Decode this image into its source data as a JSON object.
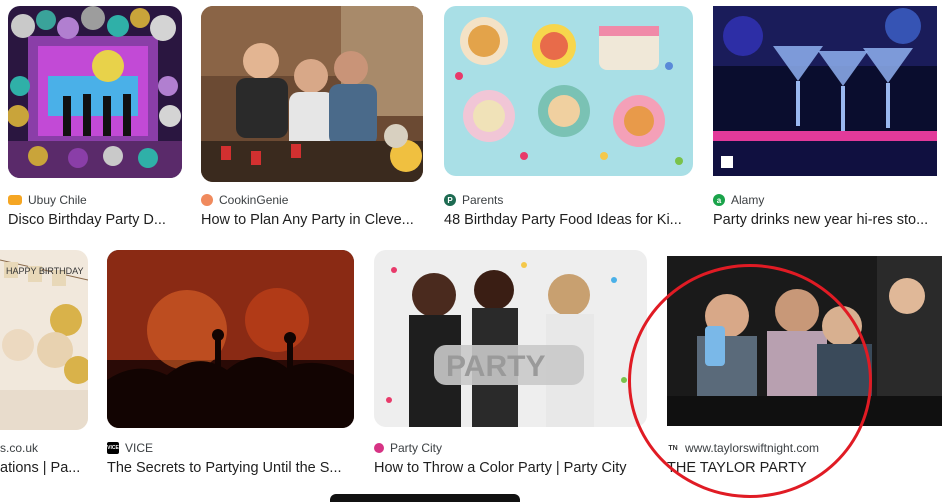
{
  "results": [
    {
      "source": "Ubuy Chile",
      "title": "Disco Birthday Party D...",
      "icon": "ubuy-logo-icon",
      "icon_color": "#f5a623"
    },
    {
      "source": "CookinGenie",
      "title": "How to Plan Any Party in Cleve...",
      "icon": "cookingenie-logo-icon",
      "icon_color": "#f08a5d"
    },
    {
      "source": "Parents",
      "title": "48 Birthday Party Food Ideas for Ki...",
      "icon": "parents-logo-icon",
      "icon_color": "#1e6b52"
    },
    {
      "source": "Alamy",
      "title": "Party drinks new year hi-res sto...",
      "icon": "alamy-logo-icon",
      "icon_color": "#1aa34a"
    },
    {
      "source": "s.co.uk",
      "title": "ations | Pa...",
      "icon": "",
      "icon_color": ""
    },
    {
      "source": "VICE",
      "title": "The Secrets to Partying Until the S...",
      "icon": "vice-logo-icon",
      "icon_color": "#000000"
    },
    {
      "source": "Party City",
      "title": "How to Throw a Color Party | Party City",
      "icon": "partycity-logo-icon",
      "icon_color": "#d63384"
    },
    {
      "source": "www.taylorswiftnight.com",
      "title": "THE TAYLOR PARTY",
      "icon": "tsn-logo-icon",
      "icon_color": "#333333"
    }
  ],
  "balloon_text": "PARTY",
  "banner_text": "HAPPY BIRTHDAY",
  "vice_icon_text": "VICE",
  "tsn_icon_text": "TN",
  "highlight_color": "#e01b24"
}
